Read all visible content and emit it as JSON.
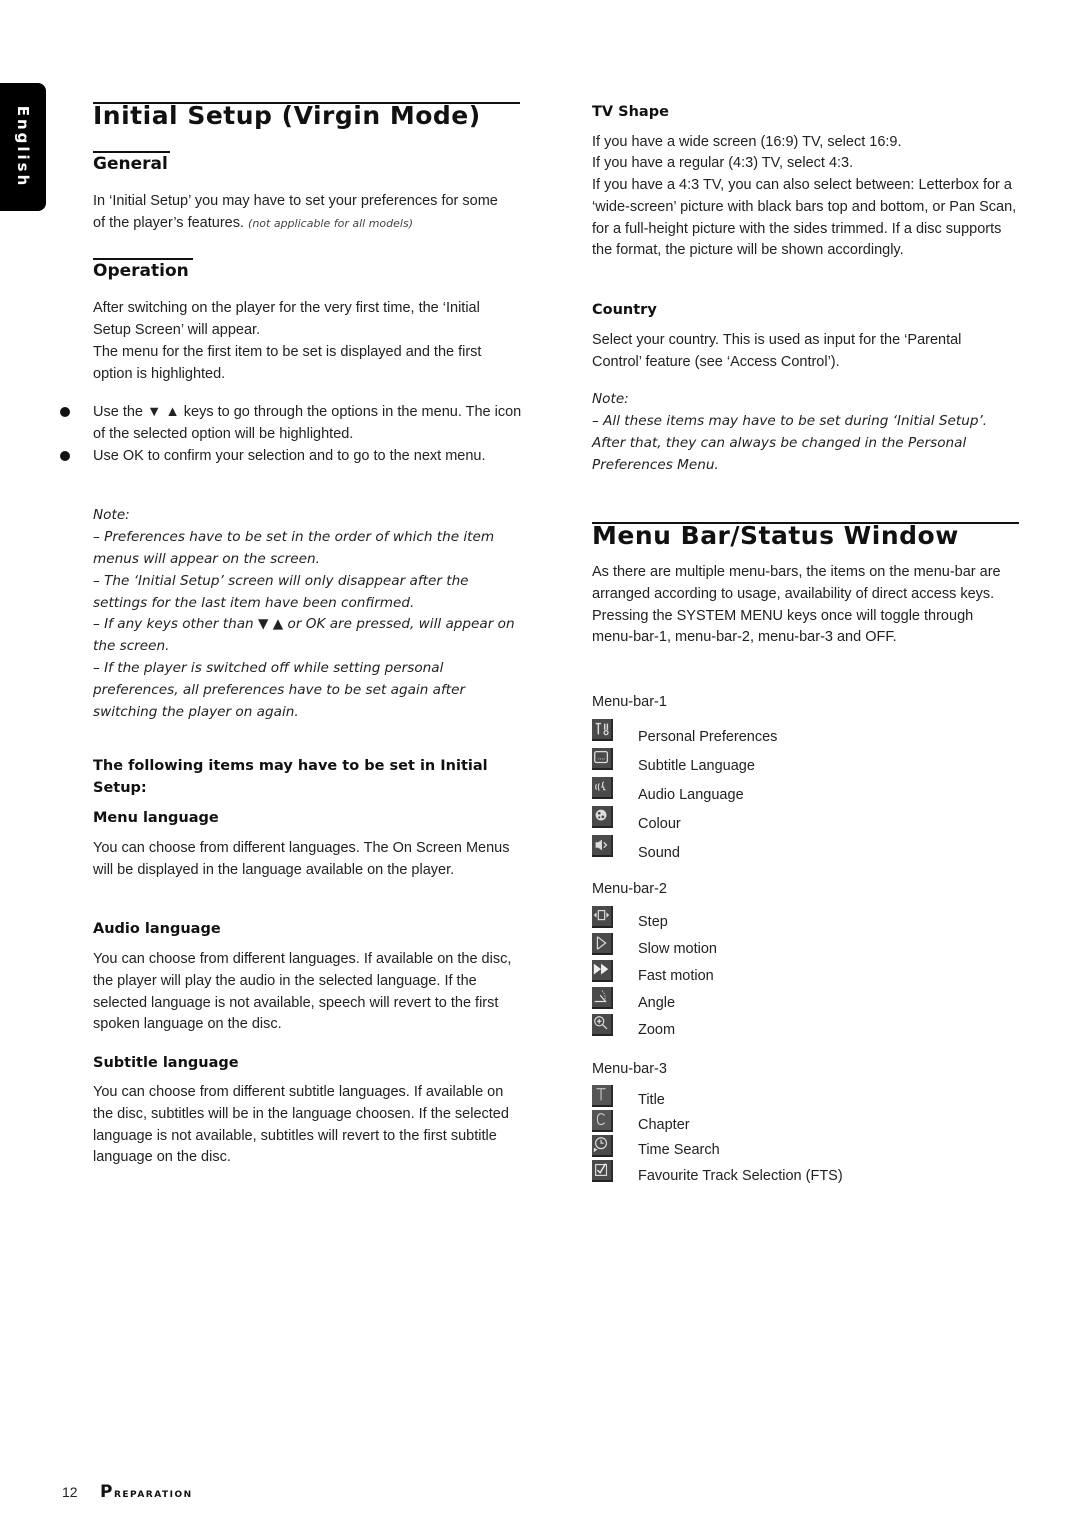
{
  "language_tab": "English",
  "left": {
    "title": "Initial Setup (Virgin Mode)",
    "general": {
      "heading": "General",
      "text": "In ‘Initial Setup’ you may have to set your preferences for some of the player’s features.",
      "note_small": "(not applicable for all models)"
    },
    "operation": {
      "heading": "Operation",
      "para1": "After switching on the player for the very first time, the ‘Initial Setup Screen’ will appear.",
      "para2": "The menu for the first item to be set is displayed and the first option is highlighted.",
      "bullets": [
        "Use the ▼ ▲ keys to go through the options in the menu. The icon of the selected option will be highlighted.",
        "Use OK to confirm your selection and to go to the next menu."
      ],
      "note_label": "Note:",
      "notes": [
        "–  Preferences have to be set in the order of which the item menus will appear on the screen.",
        "–  The ‘Initial Setup’ screen will only disappear after the settings for the last item have been confirmed.",
        "–  If any keys other than ▼ ▲ or OK are pressed,      will appear on the screen.",
        "–  If the player is switched off while setting personal preferences, all preferences have to be set again after switching the player on again."
      ]
    },
    "items_heading": "The following items may have to be set in Initial Setup:",
    "menu_language": {
      "heading": "Menu language",
      "text": "You can choose from different languages. The On Screen Menus will be displayed in the language available on the player."
    },
    "audio_language": {
      "heading": "Audio language",
      "text": "You can choose from different languages. If available on the disc, the player will play the audio in the selected language. If the selected language is not available, speech will revert to the first spoken language on the disc."
    },
    "subtitle_language": {
      "heading": "Subtitle language",
      "text": "You can choose from different subtitle languages. If available on the disc, subtitles will be in the language choosen. If the selected language is not available, subtitles will revert to the first subtitle language on the disc."
    }
  },
  "right": {
    "tv_shape": {
      "heading": "TV Shape",
      "lines": [
        "If you have a wide screen (16:9) TV, select 16:9.",
        "If you have a regular (4:3) TV, select 4:3.",
        "If you have a 4:3 TV, you can also select between: Letterbox for a ‘wide-screen’ picture with black bars top and bottom, or Pan Scan, for a full-height picture with the sides trimmed. If a disc supports the format, the picture will be shown accordingly."
      ]
    },
    "country": {
      "heading": "Country",
      "text": "Select your country. This is used as input for the ‘Parental Control’ feature (see ‘Access Control’)."
    },
    "note_label": "Note:",
    "note_text": "–  All these items may have to be set during ‘Initial Setup’. After that, they can always be changed in the Personal Preferences Menu.",
    "menubar": {
      "title": "Menu Bar/Status Window",
      "intro": "As there are multiple menu-bars, the items on the menu-bar are arranged according to usage, availability of direct access keys. Pressing the SYSTEM MENU keys once will toggle through menu-bar-1, menu-bar-2, menu-bar-3 and OFF.",
      "bars": [
        {
          "label": "Menu-bar-1",
          "items": [
            {
              "icon": "personal-preferences-icon",
              "label": "Personal Preferences"
            },
            {
              "icon": "subtitle-icon",
              "label": "Subtitle Language"
            },
            {
              "icon": "audio-language-icon",
              "label": "Audio Language"
            },
            {
              "icon": "colour-icon",
              "label": "Colour"
            },
            {
              "icon": "sound-icon",
              "label": "Sound"
            }
          ]
        },
        {
          "label": "Menu-bar-2",
          "items": [
            {
              "icon": "step-icon",
              "label": "Step"
            },
            {
              "icon": "slow-motion-icon",
              "label": "Slow motion"
            },
            {
              "icon": "fast-motion-icon",
              "label": "Fast motion"
            },
            {
              "icon": "angle-icon",
              "label": "Angle"
            },
            {
              "icon": "zoom-icon",
              "label": "Zoom"
            }
          ]
        },
        {
          "label": "Menu-bar-3",
          "items": [
            {
              "icon": "title-icon",
              "label": "Title"
            },
            {
              "icon": "chapter-icon",
              "label": "Chapter"
            },
            {
              "icon": "time-search-icon",
              "label": "Time Search"
            },
            {
              "icon": "fts-icon",
              "label": "Favourite Track Selection (FTS)"
            }
          ]
        }
      ]
    }
  },
  "footer": {
    "page_number": "12",
    "section": "Preparation"
  }
}
